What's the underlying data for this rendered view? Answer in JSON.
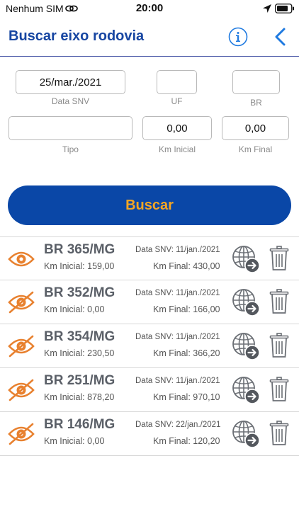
{
  "status": {
    "carrier": "Nenhum SIM",
    "time": "20:00"
  },
  "nav": {
    "title": "Buscar eixo rodovia"
  },
  "form": {
    "data_snv": {
      "value": "25/mar./2021",
      "label": "Data SNV"
    },
    "uf": {
      "value": "",
      "label": "UF"
    },
    "br": {
      "value": "",
      "label": "BR"
    },
    "tipo": {
      "value": "",
      "label": "Tipo"
    },
    "km_inicial": {
      "value": "0,00",
      "label": "Km Inicial"
    },
    "km_final": {
      "value": "0,00",
      "label": "Km Final"
    },
    "search_button": "Buscar"
  },
  "colors": {
    "brand_blue": "#0a47a7",
    "accent_orange": "#e8812f",
    "button_text": "#f5a623"
  },
  "results": [
    {
      "road": "BR 365/MG",
      "data_snv": "Data SNV: 11/jan./2021",
      "km_inicial": "Km Inicial: 159,00",
      "km_final": "Km Final: 430,00",
      "visible": true
    },
    {
      "road": "BR 352/MG",
      "data_snv": "Data SNV: 11/jan./2021",
      "km_inicial": "Km Inicial: 0,00",
      "km_final": "Km Final: 166,00",
      "visible": false
    },
    {
      "road": "BR 354/MG",
      "data_snv": "Data SNV: 11/jan./2021",
      "km_inicial": "Km Inicial: 230,50",
      "km_final": "Km Final: 366,20",
      "visible": false
    },
    {
      "road": "BR 251/MG",
      "data_snv": "Data SNV: 11/jan./2021",
      "km_inicial": "Km Inicial: 878,20",
      "km_final": "Km Final: 970,10",
      "visible": false
    },
    {
      "road": "BR 146/MG",
      "data_snv": "Data SNV: 22/jan./2021",
      "km_inicial": "Km Inicial: 0,00",
      "km_final": "Km Final: 120,20",
      "visible": false
    }
  ]
}
